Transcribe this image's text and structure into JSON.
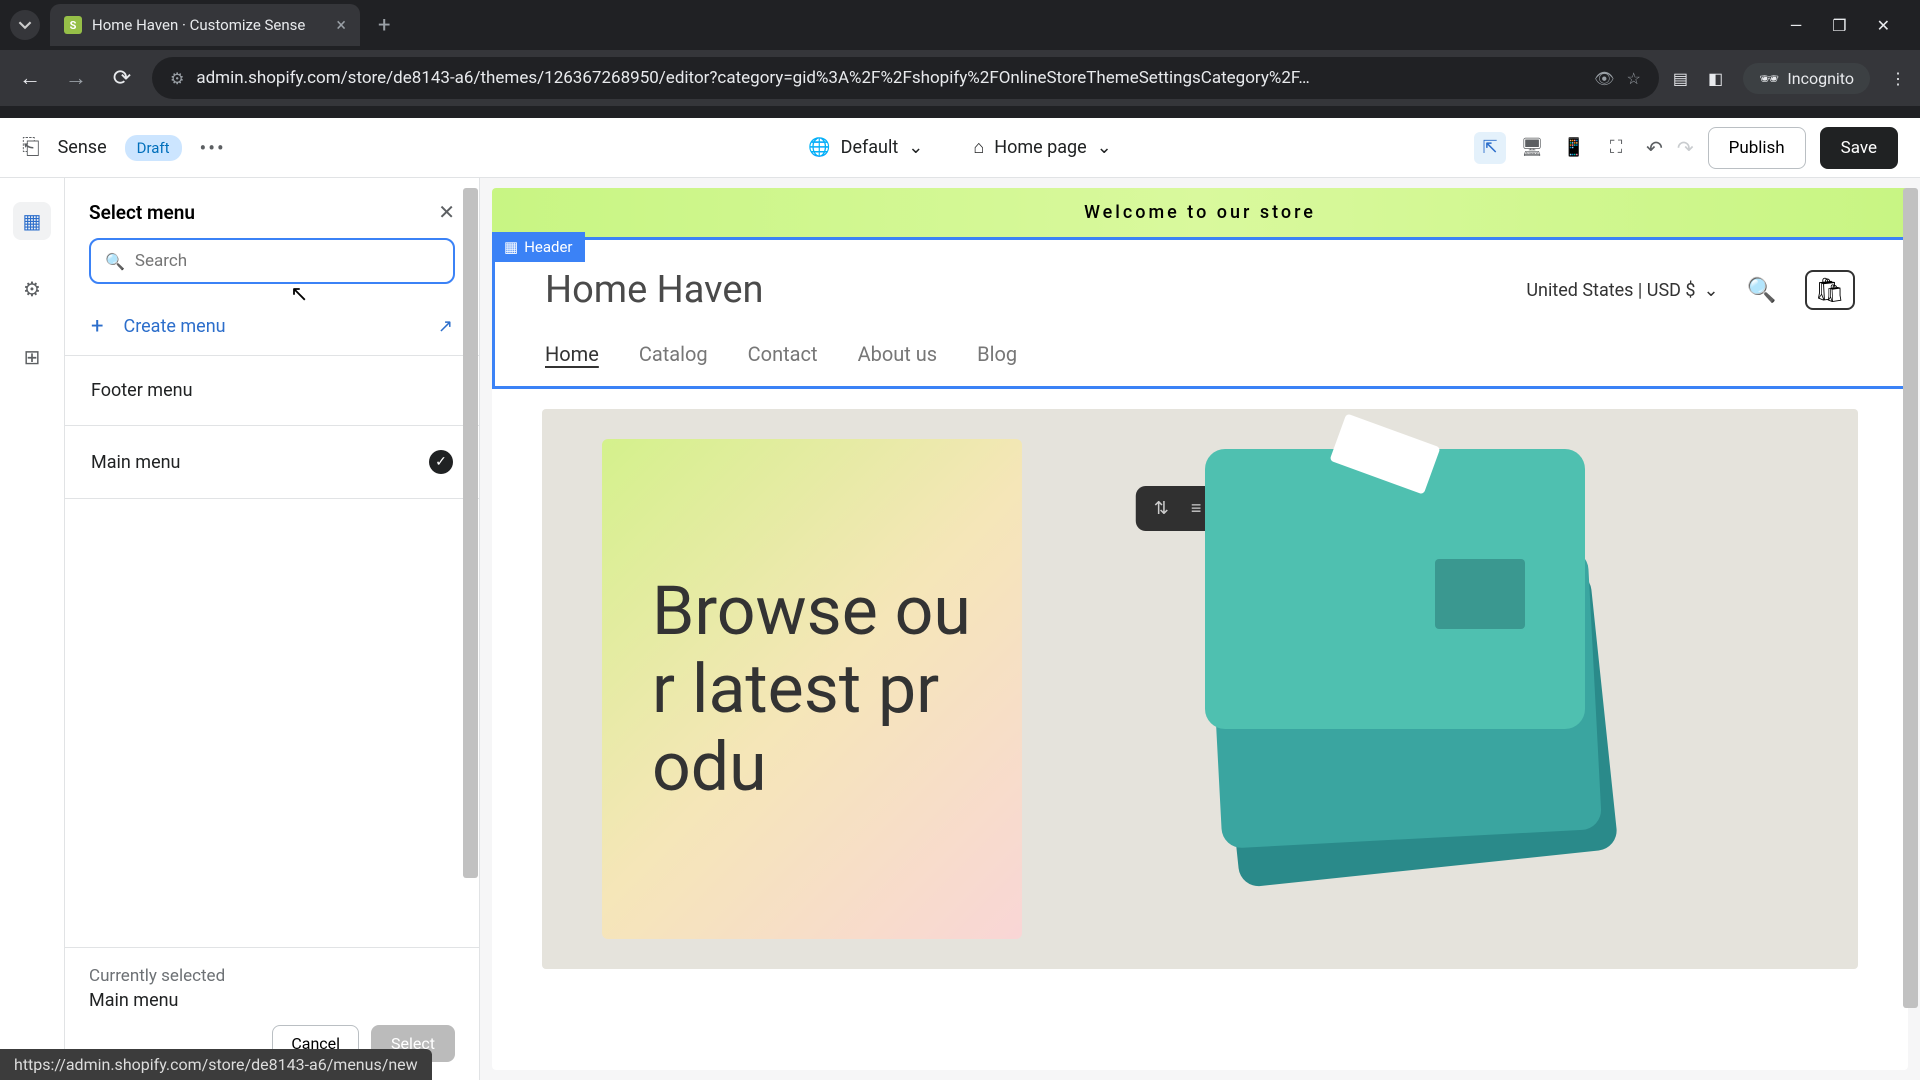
{
  "browser": {
    "tab_title": "Home Haven · Customize Sense",
    "url": "admin.shopify.com/store/de8143-a6/themes/126367268950/editor?category=gid%3A%2F%2Fshopify%2FOnlineStoreThemeSettingsCategory%2F…",
    "incognito_label": "Incognito",
    "status_url": "https://admin.shopify.com/store/de8143-a6/menus/new"
  },
  "topbar": {
    "theme_name": "Sense",
    "draft_label": "Draft",
    "template_selector": "Default",
    "page_selector": "Home page",
    "publish_label": "Publish",
    "save_label": "Save"
  },
  "side_panel": {
    "title": "Select menu",
    "search_placeholder": "Search",
    "create_label": "Create menu",
    "menus": [
      {
        "label": "Footer menu",
        "selected": false
      },
      {
        "label": "Main menu",
        "selected": true
      }
    ],
    "currently_label": "Currently selected",
    "currently_value": "Main menu",
    "cancel_label": "Cancel",
    "select_label": "Select"
  },
  "preview": {
    "announcement": "Welcome to our store",
    "header_tag": "Header",
    "store_name": "Home Haven",
    "region": "United States | USD $",
    "nav": [
      "Home",
      "Catalog",
      "Contact",
      "About us",
      "Blog"
    ],
    "hero_text": "Browse our latest produ"
  }
}
